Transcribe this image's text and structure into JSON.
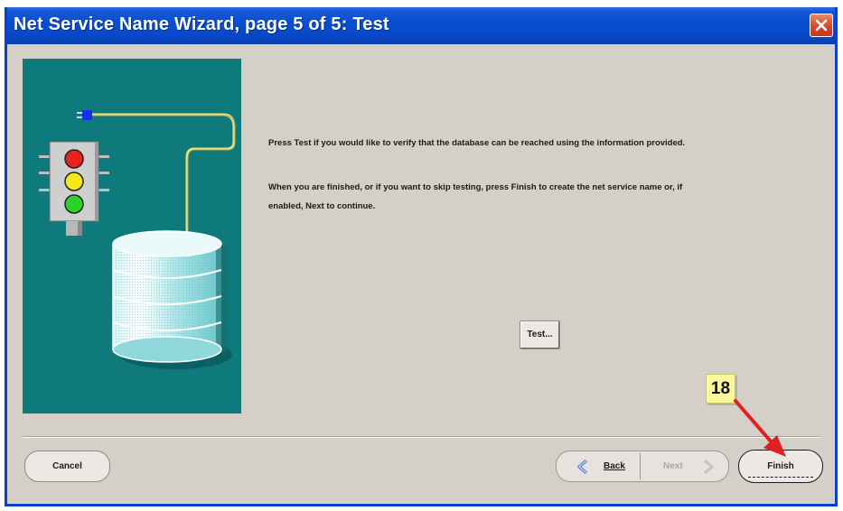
{
  "window": {
    "title": "Net Service Name Wizard, page 5 of 5: Test",
    "close_icon": "close-icon"
  },
  "illustration": {
    "icon_names": [
      "traffic-light-icon",
      "database-icon",
      "plug-icon"
    ],
    "background": "#0f7a7c",
    "light_colors": [
      "#e8221e",
      "#f2e81a",
      "#2ad22a"
    ]
  },
  "content": {
    "line1": "Press Test if you would like to verify that the database can be reached using the information provided.",
    "line2a": "When you are finished, or if you want to skip testing, press Finish to create the net service name or, if",
    "line2b": "enabled, Next to continue."
  },
  "buttons": {
    "test": "Test...",
    "cancel": "Cancel",
    "back": "Back",
    "next": "Next",
    "finish": "Finish"
  },
  "annotation": {
    "step_number": "18",
    "arrow_color": "#e02020",
    "badge_color": "#fbf79a"
  }
}
